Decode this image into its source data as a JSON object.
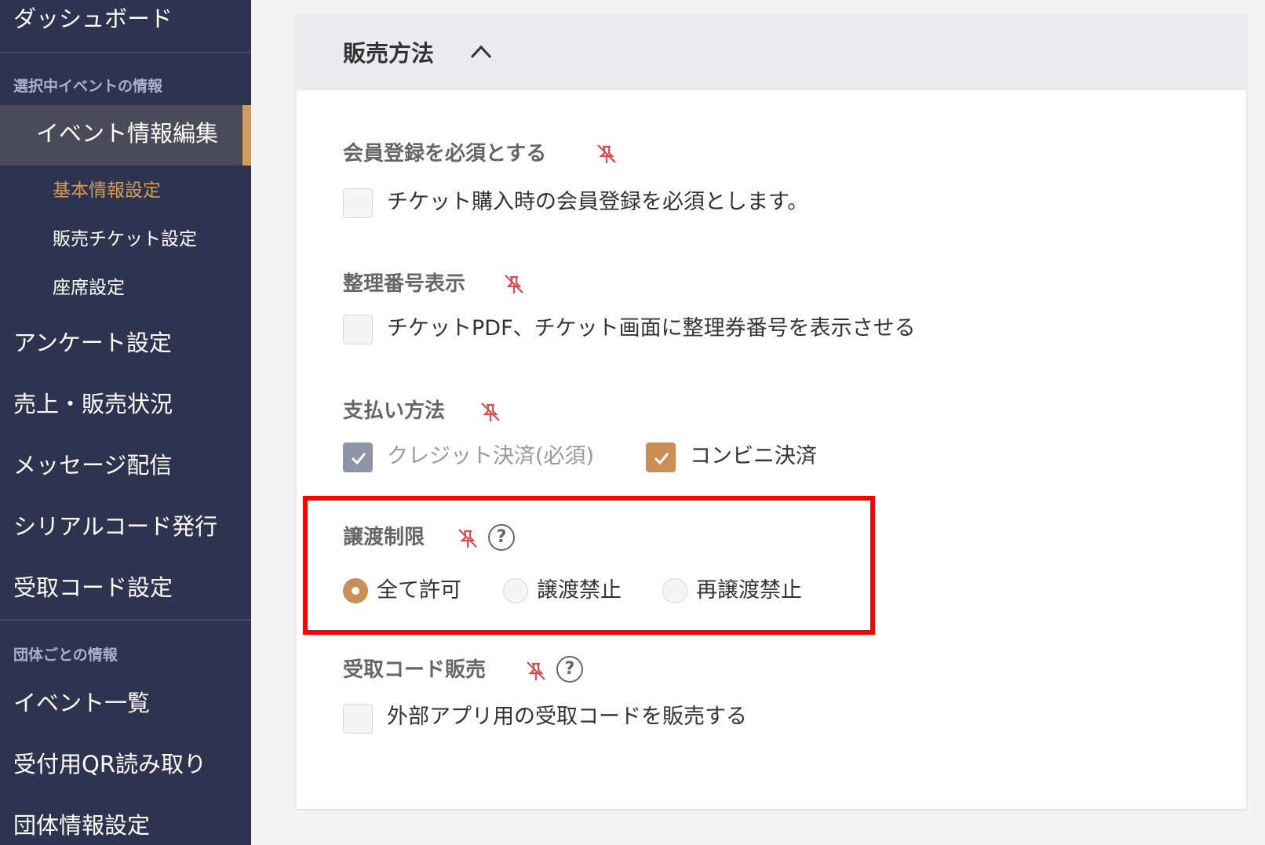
{
  "sidebar": {
    "dashboard": "ダッシュボード",
    "section_event": "選択中イベントの情報",
    "active_item": "イベント情報編集",
    "sub_items": [
      "基本情報設定",
      "販売チケット設定",
      "座席設定"
    ],
    "items": [
      "アンケート設定",
      "売上・販売状況",
      "メッセージ配信",
      "シリアルコード発行",
      "受取コード設定"
    ],
    "section_org": "団体ごとの情報",
    "org_items": [
      "イベント一覧",
      "受付用QR読み取り",
      "団体情報設定"
    ]
  },
  "card": {
    "title": "販売方法",
    "fields": {
      "membership": {
        "label": "会員登録を必須とする",
        "option": "チケット購入時の会員登録を必須とします。",
        "checked": false
      },
      "ticket_number": {
        "label": "整理番号表示",
        "option": "チケットPDF、チケット画面に整理券番号を表示させる",
        "checked": false
      },
      "payment": {
        "label": "支払い方法",
        "options": [
          {
            "label": "クレジット決済(必須)",
            "checked": true,
            "disabled": true
          },
          {
            "label": "コンビニ決済",
            "checked": true,
            "disabled": false
          }
        ]
      },
      "transfer": {
        "label": "譲渡制限",
        "help": "?",
        "options": [
          {
            "label": "全て許可",
            "selected": true
          },
          {
            "label": "譲渡禁止",
            "selected": false
          },
          {
            "label": "再譲渡禁止",
            "selected": false
          }
        ]
      },
      "receive_code": {
        "label": "受取コード販売",
        "help": "?",
        "option": "外部アプリ用の受取コードを販売する",
        "checked": false
      }
    }
  },
  "colors": {
    "sidebar_bg": "#2e3450",
    "accent": "#c98f55",
    "highlight": "#ff0000",
    "pin": "#e04a4a"
  },
  "icons": {
    "pin": "pin-off-icon",
    "help": "question-circle-icon",
    "chevron": "chevron-up-icon",
    "check": "check-icon"
  }
}
